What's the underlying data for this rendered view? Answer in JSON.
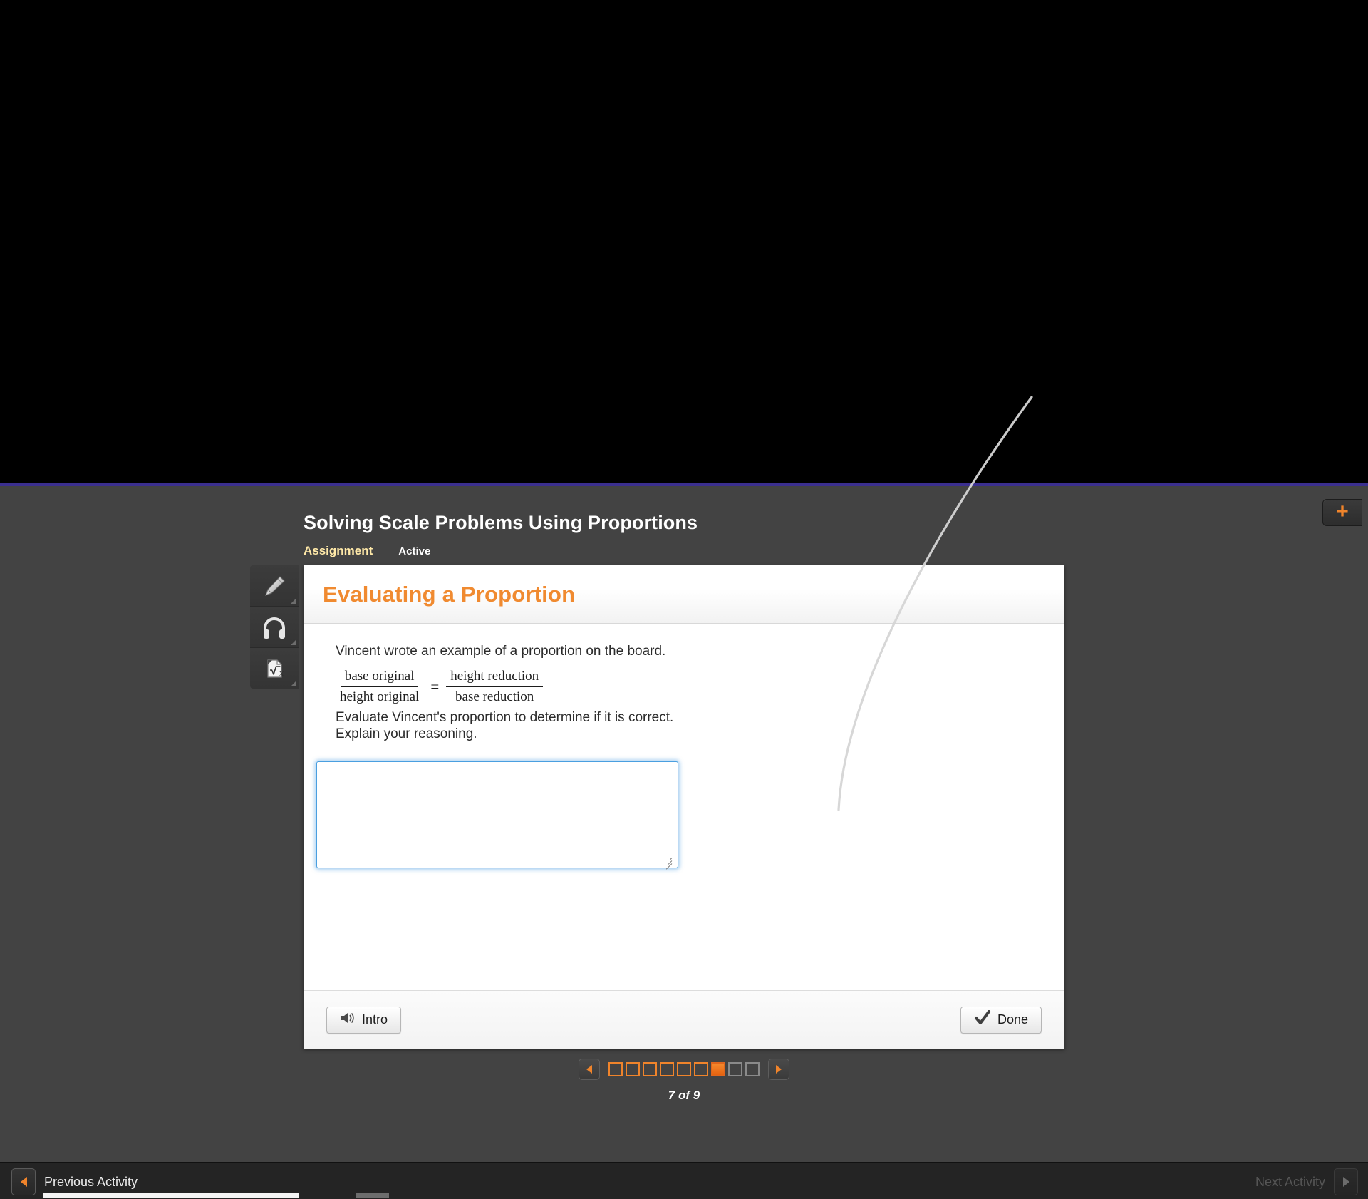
{
  "activity": {
    "title": "Solving Scale Problems Using Proportions",
    "kind": "Assignment",
    "state": "Active"
  },
  "plus_button": {
    "glyph": "+",
    "color": "#f0842b",
    "name": "add"
  },
  "tool_rail": {
    "items": [
      {
        "icon": "highlighter-pencil-icon",
        "label": "Highlighter"
      },
      {
        "icon": "headphones-icon",
        "label": "Audio"
      },
      {
        "icon": "math-sqrt-icon",
        "label": "Math Tools"
      }
    ]
  },
  "card": {
    "header_title": "Evaluating a Proportion",
    "intro": "Vincent wrote an example of a proportion on the board.",
    "proportion": {
      "left_numerator": "base original",
      "left_denominator": "height original",
      "operator": "=",
      "right_numerator": "height reduction",
      "right_denominator": "base reduction"
    },
    "prompt_line_1": "Evaluate Vincent's proportion to determine if it is correct.",
    "prompt_line_2": "Explain your reasoning.",
    "response": {
      "value": "",
      "placeholder": ""
    },
    "footer": {
      "intro_button": "Intro",
      "intro_icon": "speaker-icon",
      "done_button": "Done",
      "done_icon": "checkmark-icon"
    }
  },
  "pager": {
    "prev_icon": "triangle-left-icon",
    "next_icon": "triangle-right-icon",
    "label": "7 of 9",
    "current": 7,
    "total": 9,
    "states": [
      "visited",
      "visited",
      "visited",
      "visited",
      "visited",
      "visited",
      "current",
      "future",
      "future"
    ]
  },
  "activity_bar": {
    "previous_label": "Previous Activity",
    "previous_icon": "triangle-left-icon",
    "next_label": "Next Activity",
    "next_icon": "triangle-right-icon",
    "next_enabled": false
  },
  "colors": {
    "accent_orange": "#f0842b",
    "header_orange": "#f08a30",
    "stage_gray": "#434343",
    "rule_purple": "#3b2f8f",
    "focus_blue": "#4a9fe0",
    "kind_yellow": "#ffe9a8"
  }
}
